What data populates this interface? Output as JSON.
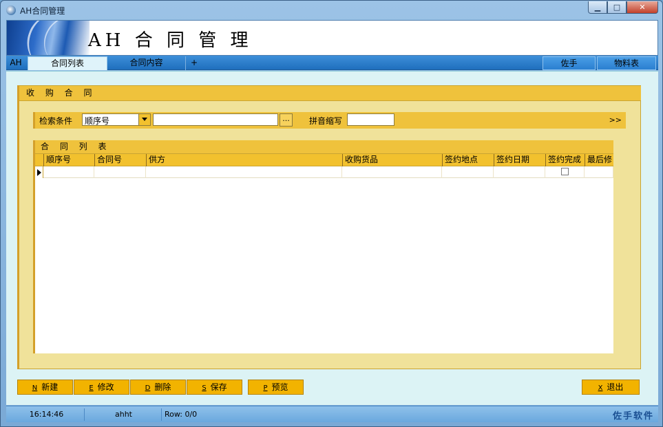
{
  "window": {
    "title": "AH合同管理",
    "minimize_symbol": "▁",
    "maximize_symbol": "□",
    "close_symbol": "✕"
  },
  "header": {
    "title": "AH 合 同 管 理"
  },
  "tabs": {
    "ah": "AH",
    "list": "合同列表",
    "content": "合同内容",
    "plus": "+",
    "assistant": "佐手",
    "materials": "物料表"
  },
  "group": {
    "title": "收 购 合 同"
  },
  "search": {
    "label": "检索条件",
    "select_value": "顺序号",
    "input_value": "",
    "ellipsis": "...",
    "pinyin_label": "拼音缩写",
    "pinyin_value": "",
    "expand": ">>"
  },
  "grid": {
    "title": "合 同 列 表",
    "columns": [
      "顺序号",
      "合同号",
      "供方",
      "收购货品",
      "签约地点",
      "签约日期",
      "签约完成",
      "最后修"
    ],
    "rows": [
      {
        "values": [
          "",
          "",
          "",
          "",
          "",
          "",
          "",
          ""
        ],
        "completed": false
      }
    ]
  },
  "buttons": {
    "new": {
      "key": "N",
      "label": "新建"
    },
    "edit": {
      "key": "E",
      "label": "修改"
    },
    "delete": {
      "key": "D",
      "label": "删除"
    },
    "save": {
      "key": "S",
      "label": "保存"
    },
    "preview": {
      "key": "P",
      "label": "预览"
    },
    "exit": {
      "key": "X",
      "label": "退出"
    }
  },
  "status": {
    "time": "16:14:46",
    "user": "ahht",
    "row": "Row: 0/0",
    "brand": "佐手软件"
  },
  "colors": {
    "accent_gold": "#efc23c",
    "panel_yellow": "#f0e29a",
    "button_orange": "#f2b300",
    "tab_blue": "#1f6fbd",
    "background_cyan": "#dcf3f5"
  }
}
